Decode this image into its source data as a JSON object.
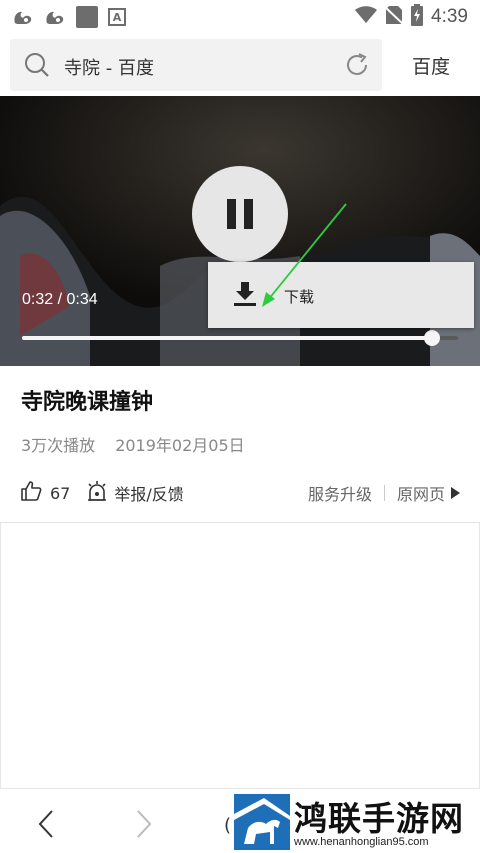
{
  "status_bar": {
    "time": "4:39",
    "icons": [
      "uc-browser-icon",
      "uc-browser-icon",
      "gallery-icon",
      "font-a-icon",
      "wifi-icon",
      "no-sim-icon",
      "battery-charging-icon"
    ],
    "badge_letter": "A"
  },
  "search": {
    "query": "寺院 - 百度",
    "engine_button": "百度",
    "icons": [
      "search-icon",
      "refresh-icon"
    ]
  },
  "player": {
    "current_time": "0:32",
    "duration": "0:34",
    "time_display": "0:32 / 0:34",
    "progress_fraction": 0.94,
    "state": "playing",
    "controls": [
      "pause-icon"
    ],
    "context_menu": {
      "download_label": "下载",
      "icon": "download-icon"
    },
    "annotation_arrow_color": "#2ecc40"
  },
  "video": {
    "title": "寺院晚课撞钟",
    "plays": "3万次播放",
    "date": "2019年02月05日",
    "likes": "67",
    "report_label": "举报/反馈",
    "service_upgrade": "服务升级",
    "original_page": "原网页"
  },
  "bottom_nav": {
    "icons": [
      "back-arrow-icon",
      "forward-arrow-icon"
    ],
    "partial_glyph": "("
  },
  "watermark": {
    "title": "鸿联手游网",
    "url": "www.henanhonglian95.com",
    "brand_color": "#1f6fb8"
  },
  "colors": {
    "accent_green": "#2ecc40",
    "search_bg": "#f2f2f2",
    "menu_bg": "#e8e8e8"
  }
}
